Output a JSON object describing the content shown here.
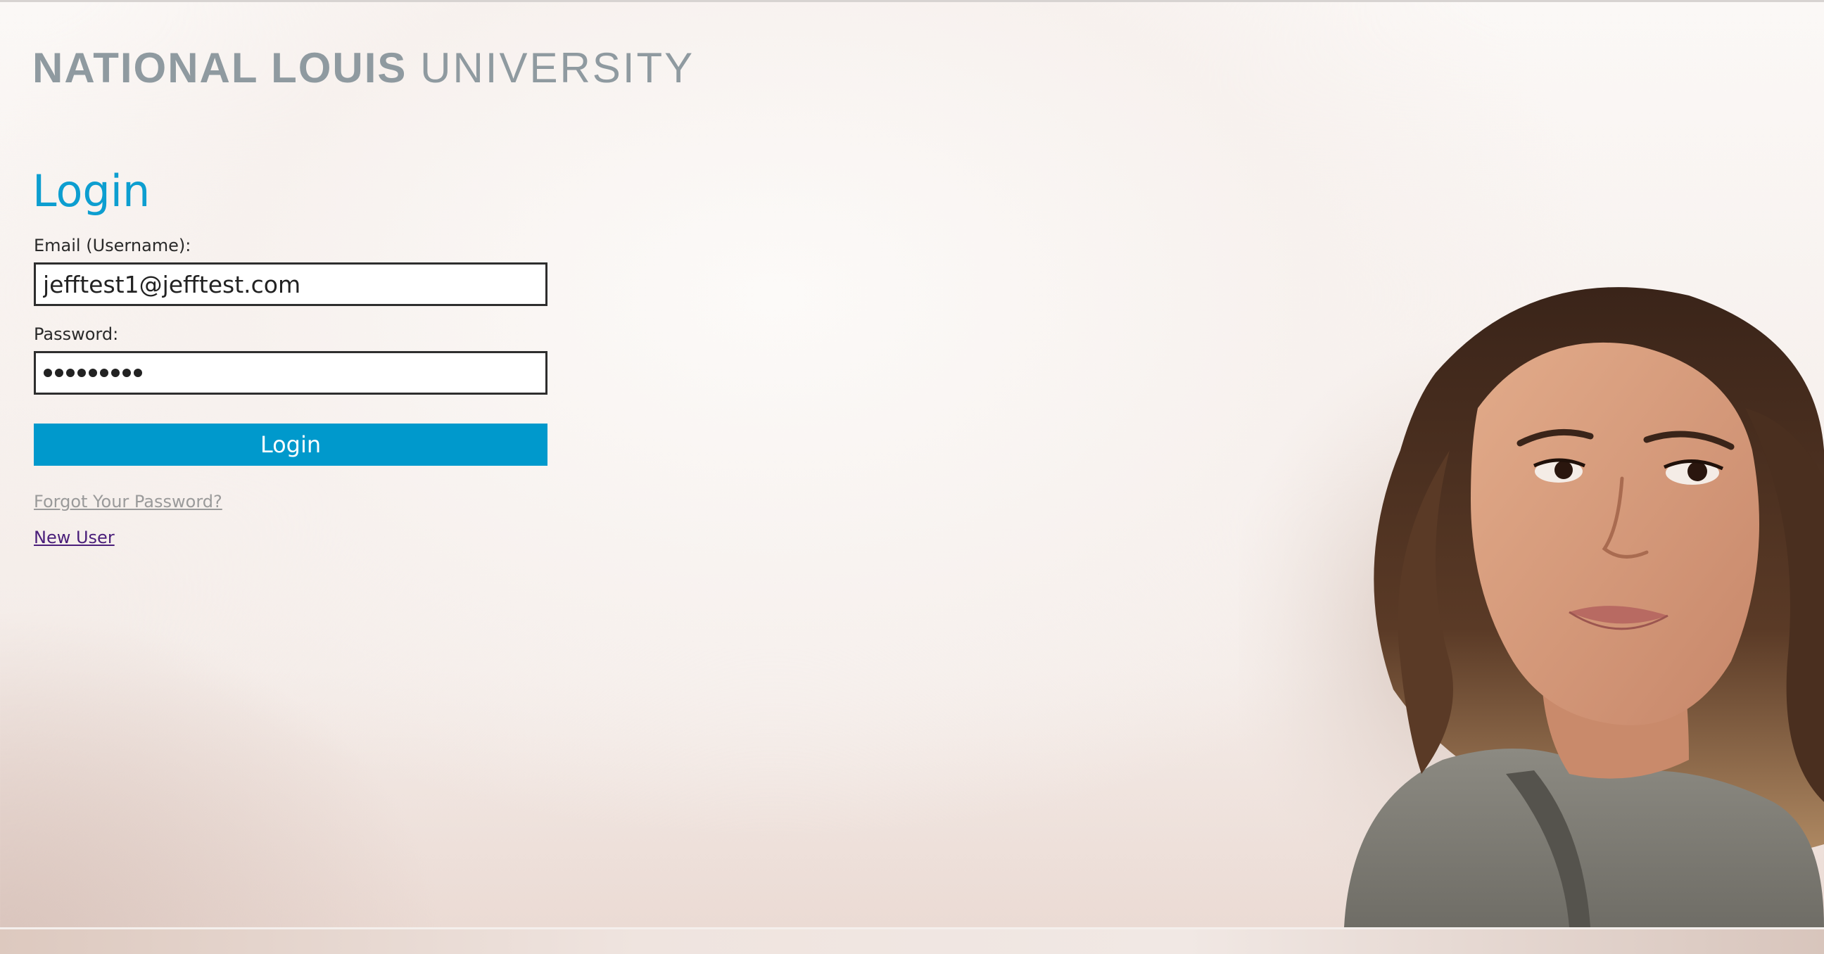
{
  "header": {
    "brand_bold": "NATIONAL LOUIS",
    "brand_light": "UNIVERSITY"
  },
  "login_form": {
    "title": "Login",
    "email_label": "Email (Username):",
    "email_value": "jefftest1@jefftest.com",
    "password_label": "Password:",
    "password_masked_length": 9,
    "submit_label": "Login",
    "forgot_password_link": "Forgot Your Password?",
    "new_user_link": "New User"
  },
  "colors": {
    "accent": "#0099cc",
    "title": "#0d9ed0",
    "logo": "#8f9aa0",
    "visited_link": "#9a9a9a",
    "link": "#4a1e7a"
  }
}
